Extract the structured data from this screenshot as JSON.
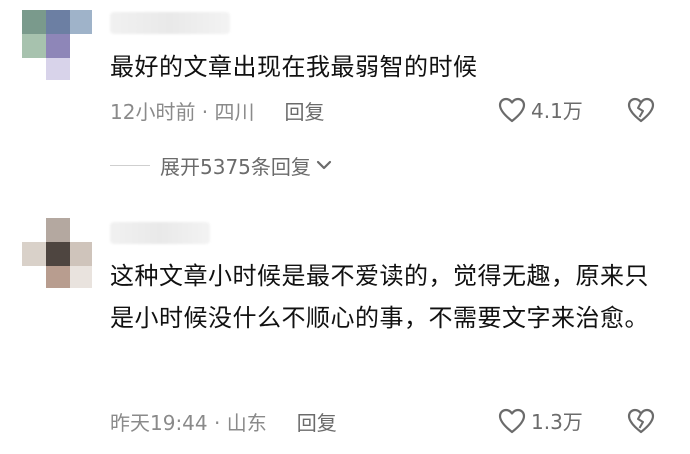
{
  "comments": [
    {
      "text": "最好的文章出现在我最弱智的时候",
      "meta": "12小时前 · 四川",
      "reply_label": "回复",
      "likes": "4.1万",
      "expand_label": "展开5375条回复"
    },
    {
      "text": "这种文章小时候是最不爱读的，觉得无趣，原来只是小时候没什么不顺心的事，不需要文字来治愈。",
      "meta": "昨天19:44 · 山东",
      "reply_label": "回复",
      "likes": "1.3万"
    }
  ],
  "icons": {
    "like": "heart-outline-icon",
    "dislike": "broken-heart-icon",
    "expand": "chevron-down-icon"
  },
  "colors": {
    "meta_text": "#8a8a8a",
    "action_text": "#6b6b6b",
    "icon_stroke": "#6b6b6b"
  }
}
